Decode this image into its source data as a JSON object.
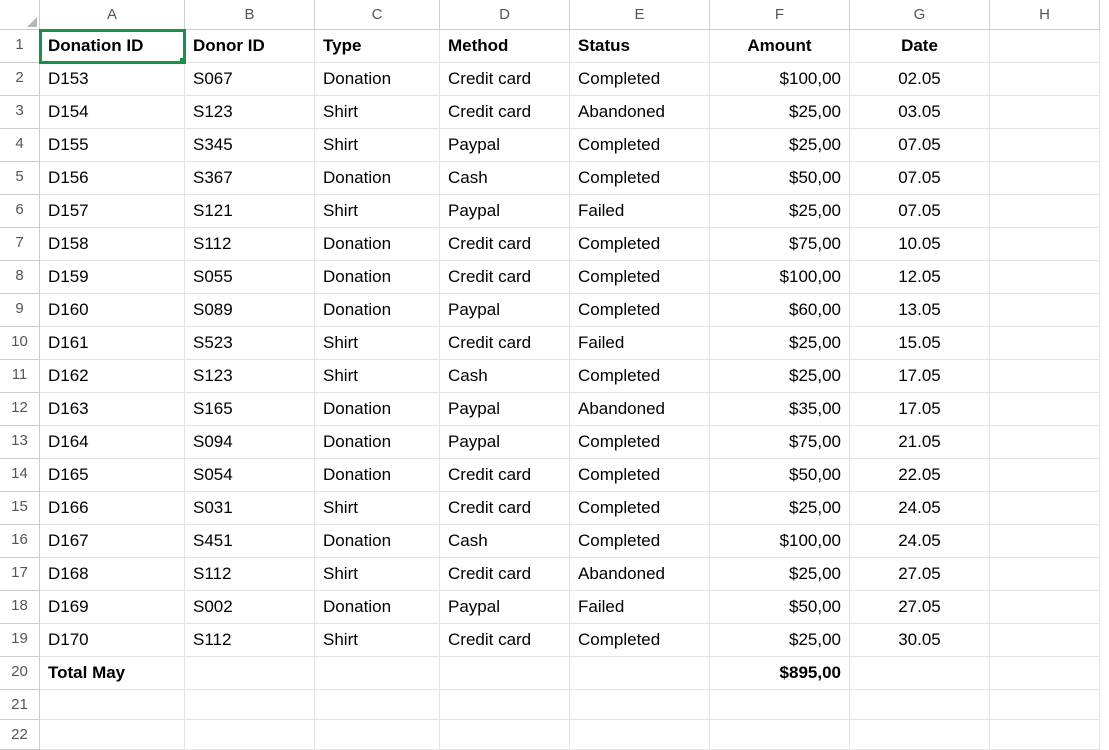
{
  "columns": [
    "A",
    "B",
    "C",
    "D",
    "E",
    "F",
    "G",
    "H"
  ],
  "headers": {
    "A": "Donation ID",
    "B": "Donor ID",
    "C": "Type",
    "D": "Method",
    "E": "Status",
    "F": "Amount",
    "G": "Date"
  },
  "rows": [
    {
      "A": "D153",
      "B": "S067",
      "C": "Donation",
      "D": "Credit card",
      "E": "Completed",
      "F": "$100,00",
      "G": "02.05"
    },
    {
      "A": "D154",
      "B": "S123",
      "C": "Shirt",
      "D": "Credit card",
      "E": "Abandoned",
      "F": "$25,00",
      "G": "03.05"
    },
    {
      "A": "D155",
      "B": "S345",
      "C": "Shirt",
      "D": "Paypal",
      "E": "Completed",
      "F": "$25,00",
      "G": "07.05"
    },
    {
      "A": "D156",
      "B": "S367",
      "C": "Donation",
      "D": "Cash",
      "E": "Completed",
      "F": "$50,00",
      "G": "07.05"
    },
    {
      "A": "D157",
      "B": "S121",
      "C": "Shirt",
      "D": "Paypal",
      "E": "Failed",
      "F": "$25,00",
      "G": "07.05"
    },
    {
      "A": "D158",
      "B": "S112",
      "C": "Donation",
      "D": "Credit card",
      "E": "Completed",
      "F": "$75,00",
      "G": "10.05"
    },
    {
      "A": "D159",
      "B": "S055",
      "C": "Donation",
      "D": "Credit card",
      "E": "Completed",
      "F": "$100,00",
      "G": "12.05"
    },
    {
      "A": "D160",
      "B": "S089",
      "C": "Donation",
      "D": "Paypal",
      "E": "Completed",
      "F": "$60,00",
      "G": "13.05"
    },
    {
      "A": "D161",
      "B": "S523",
      "C": "Shirt",
      "D": "Credit card",
      "E": "Failed",
      "F": "$25,00",
      "G": "15.05"
    },
    {
      "A": "D162",
      "B": "S123",
      "C": "Shirt",
      "D": "Cash",
      "E": "Completed",
      "F": "$25,00",
      "G": "17.05"
    },
    {
      "A": "D163",
      "B": "S165",
      "C": "Donation",
      "D": "Paypal",
      "E": "Abandoned",
      "F": "$35,00",
      "G": "17.05"
    },
    {
      "A": "D164",
      "B": "S094",
      "C": "Donation",
      "D": "Paypal",
      "E": "Completed",
      "F": "$75,00",
      "G": "21.05"
    },
    {
      "A": "D165",
      "B": "S054",
      "C": "Donation",
      "D": "Credit card",
      "E": "Completed",
      "F": "$50,00",
      "G": "22.05"
    },
    {
      "A": "D166",
      "B": "S031",
      "C": "Shirt",
      "D": "Credit card",
      "E": "Completed",
      "F": "$25,00",
      "G": "24.05"
    },
    {
      "A": "D167",
      "B": "S451",
      "C": "Donation",
      "D": "Cash",
      "E": "Completed",
      "F": "$100,00",
      "G": "24.05"
    },
    {
      "A": "D168",
      "B": "S112",
      "C": "Shirt",
      "D": "Credit card",
      "E": "Abandoned",
      "F": "$25,00",
      "G": "27.05"
    },
    {
      "A": "D169",
      "B": "S002",
      "C": "Donation",
      "D": "Paypal",
      "E": "Failed",
      "F": "$50,00",
      "G": "27.05"
    },
    {
      "A": "D170",
      "B": "S112",
      "C": "Shirt",
      "D": "Credit card",
      "E": "Completed",
      "F": "$25,00",
      "G": "30.05"
    }
  ],
  "total": {
    "label": "Total May",
    "amount": "$895,00"
  },
  "active_cell": "A1",
  "visible_rows": 22
}
